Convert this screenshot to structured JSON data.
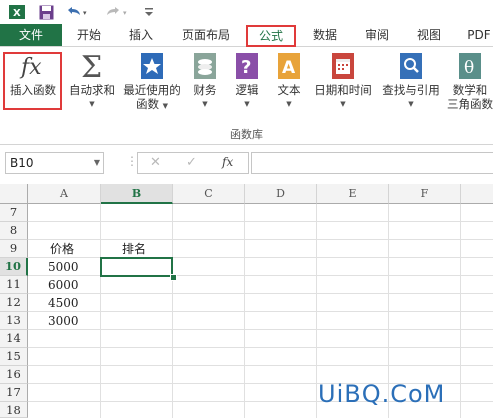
{
  "ribbon_tabs": {
    "file": "文件",
    "home": "开始",
    "insert": "插入",
    "page_layout": "页面布局",
    "formulas": "公式",
    "data": "数据",
    "review": "审阅",
    "view": "视图",
    "pdf": "PDF"
  },
  "ribbon": {
    "insert_function": "插入函数",
    "autosum": "自动求和",
    "recent": [
      "最近使用的",
      "函数"
    ],
    "financial": "财务",
    "logical": "逻辑",
    "text": "文本",
    "datetime": "日期和时间",
    "lookup": "查找与引用",
    "math": [
      "数学和",
      "三角函数"
    ],
    "group_label": "函数库"
  },
  "formula_bar": {
    "name_box": "B10",
    "fx": "fx"
  },
  "columns": [
    "A",
    "B",
    "C",
    "D",
    "E",
    "F"
  ],
  "rows": [
    "7",
    "8",
    "9",
    "10",
    "11",
    "12",
    "13",
    "14",
    "15",
    "16",
    "17",
    "18"
  ],
  "cells": {
    "A9": "价格",
    "B9": "排名",
    "A10": "5000",
    "A11": "6000",
    "A12": "4500",
    "A13": "3000"
  },
  "watermark": "UiBQ.CoM",
  "colors": {
    "excel_green": "#217346",
    "highlight_red": "#e03a3a"
  }
}
